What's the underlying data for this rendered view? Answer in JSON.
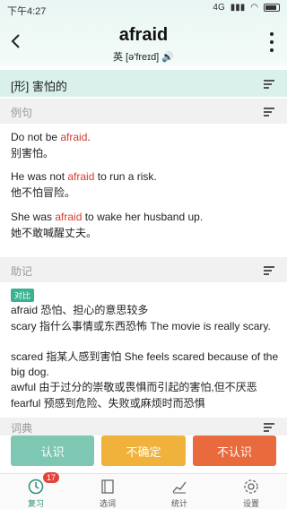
{
  "status": {
    "time": "下午4:27",
    "network": "4G"
  },
  "header": {
    "word": "afraid",
    "phonetic": "英 [ə'freɪd] 🔊"
  },
  "definition": {
    "text": "[形] 害怕的"
  },
  "examples_section": {
    "title": "例句"
  },
  "examples": [
    {
      "before": "Do not be ",
      "highlight": "afraid",
      "after": ".",
      "cn": "别害怕。"
    },
    {
      "before": "He was not ",
      "highlight": "afraid",
      "after": " to run a risk.",
      "cn": "他不怕冒险。"
    },
    {
      "before": "She was ",
      "highlight": "afraid",
      "after": " to wake her husband up.",
      "cn": "她不敢喊醒丈夫。"
    }
  ],
  "mnemonic_section": {
    "title": "助记",
    "tag": "对比"
  },
  "mnemonic": [
    "afraid   恐怕、担心的意思较多",
    "scary   指什么事情或东西恐怖   The movie is really scary.",
    "scared 指某人感到害怕   She feels scared  because of the big dog.",
    "awful   由于过分的崇敬或畏惧而引起的害怕,但不厌恶",
    "fearful  预感到危险、失败或麻烦时而恐惧"
  ],
  "dictionary_section": {
    "title": "词典"
  },
  "actions": {
    "know": "认识",
    "unsure": "不确定",
    "unknown": "不认识"
  },
  "tabs": [
    {
      "label": "复习",
      "badge": "17"
    },
    {
      "label": "选词"
    },
    {
      "label": "统计"
    },
    {
      "label": "设置"
    }
  ],
  "colors": {
    "accent": "#39b38f",
    "highlight": "#d63a2e"
  }
}
